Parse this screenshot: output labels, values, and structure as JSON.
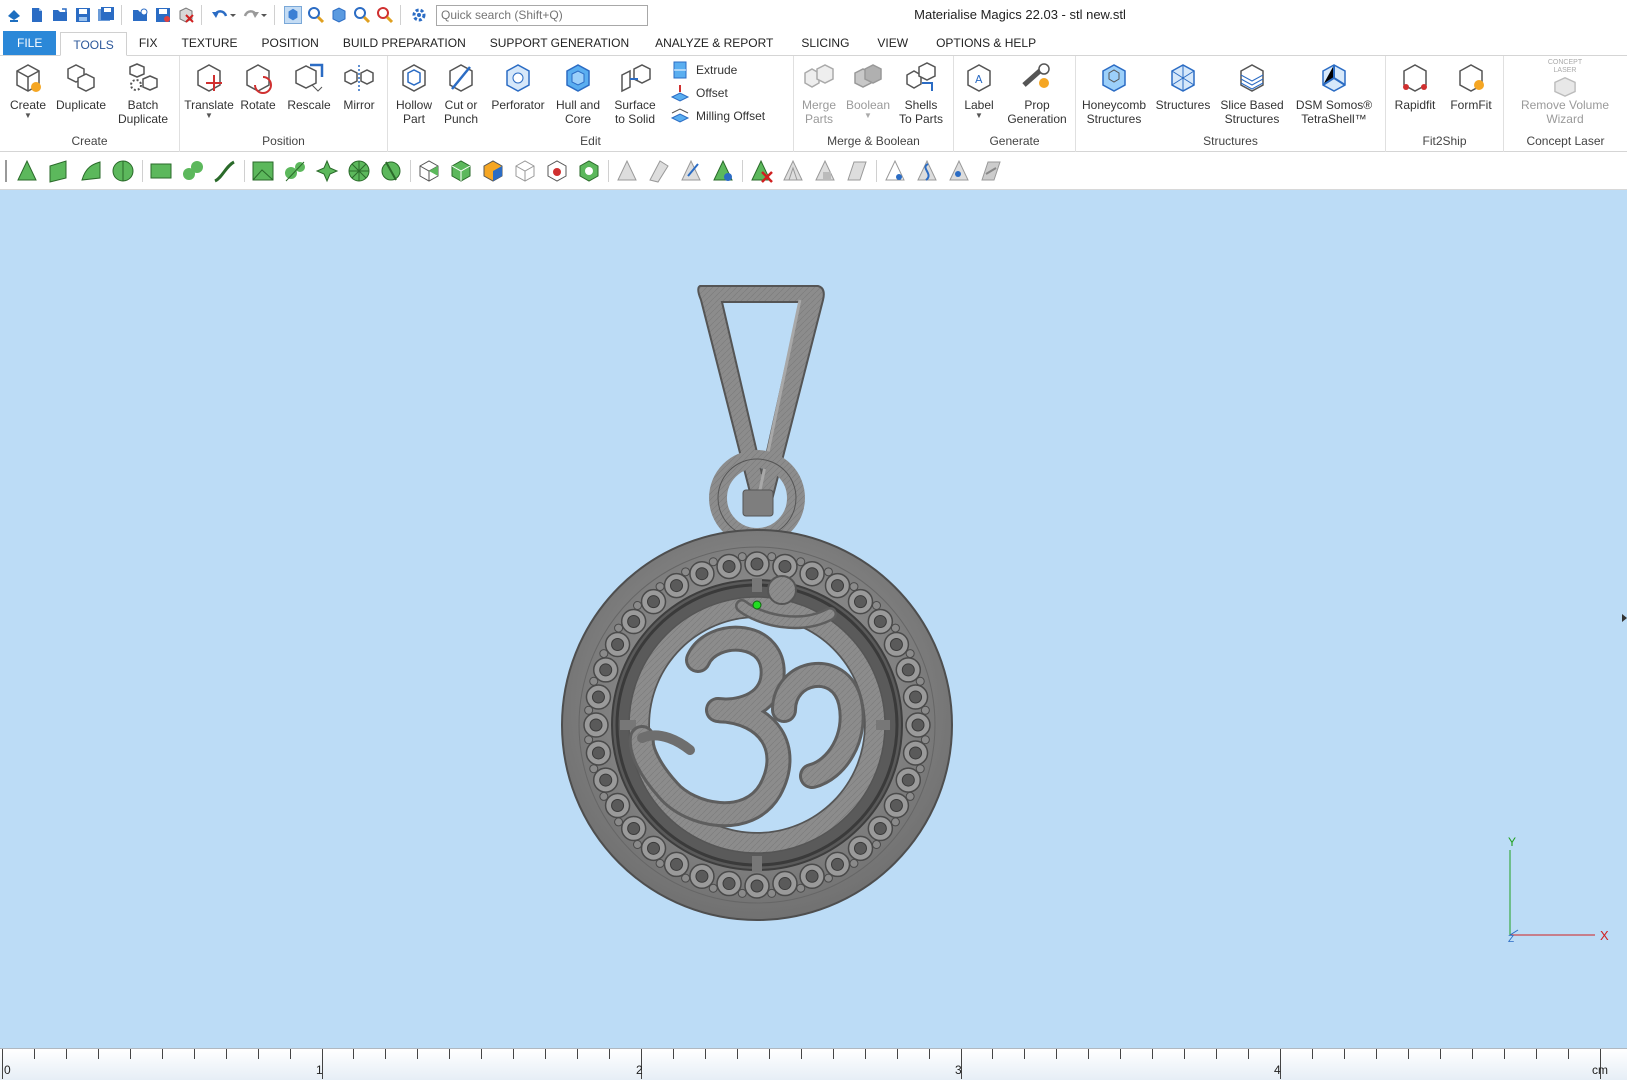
{
  "window": {
    "title": "Materialise Magics 22.03 - stl new.stl"
  },
  "quick_access": {
    "search_placeholder": "Quick search (Shift+Q)"
  },
  "tabs": [
    "FILE",
    "TOOLS",
    "FIX",
    "TEXTURE",
    "POSITION",
    "BUILD PREPARATION",
    "SUPPORT GENERATION",
    "ANALYZE & REPORT",
    "SLICING",
    "VIEW",
    "OPTIONS & HELP"
  ],
  "active_tab": "TOOLS",
  "ribbon": {
    "create": {
      "label": "Create",
      "buttons": {
        "create": "Create",
        "duplicate": "Duplicate",
        "batch_duplicate": "Batch\nDuplicate"
      }
    },
    "position": {
      "label": "Position",
      "buttons": {
        "translate": "Translate",
        "rotate": "Rotate",
        "rescale": "Rescale",
        "mirror": "Mirror"
      }
    },
    "edit": {
      "label": "Edit",
      "buttons": {
        "hollow": "Hollow\nPart",
        "cut": "Cut or\nPunch",
        "perforator": "Perforator",
        "hull": "Hull and\nCore",
        "surface": "Surface\nto Solid"
      },
      "small_buttons": {
        "extrude": "Extrude",
        "offset": "Offset",
        "milling": "Milling Offset"
      }
    },
    "merge": {
      "label": "Merge & Boolean",
      "buttons": {
        "merge_parts": "Merge\nParts",
        "boolean": "Boolean",
        "shells": "Shells\nTo Parts"
      }
    },
    "generate": {
      "label": "Generate",
      "buttons": {
        "label": "Label",
        "prop": "Prop\nGeneration"
      }
    },
    "structures": {
      "label": "Structures",
      "buttons": {
        "honeycomb": "Honeycomb\nStructures",
        "structures": "Structures",
        "slice_based": "Slice Based\nStructures",
        "dsm": "DSM Somos®\nTetraShell™"
      }
    },
    "fit2ship": {
      "label": "Fit2Ship",
      "buttons": {
        "rapidfit": "Rapidfit",
        "formfit": "FormFit"
      }
    },
    "concept_laser": {
      "label": "Concept Laser",
      "buttons": {
        "remove_volume": "Remove Volume\nWizard"
      },
      "logo_text": "CONCEPT LASER"
    }
  },
  "viewport": {
    "background_color": "#bcdcf6",
    "model_color": "#8a8a8a",
    "axes": {
      "x": "X",
      "y": "Y",
      "z": "Z"
    }
  },
  "ruler": {
    "unit": "cm",
    "labels": [
      "0",
      "1",
      "2",
      "3",
      "4"
    ]
  }
}
